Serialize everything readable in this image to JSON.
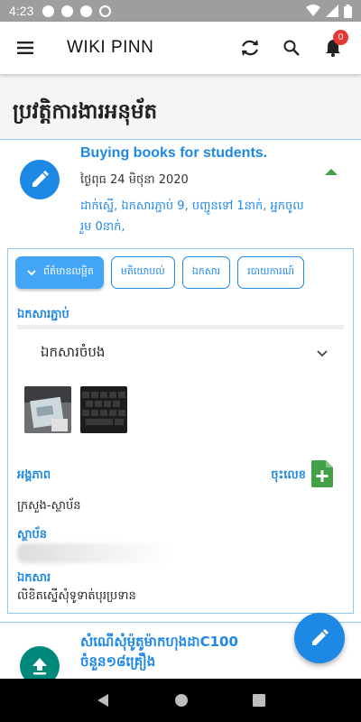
{
  "status_bar": {
    "time": "4:23"
  },
  "app_bar": {
    "title": "WIKI PINN",
    "notification_count": "0"
  },
  "page": {
    "title": "ប្រវត្តិការងារអនុម័ត"
  },
  "item": {
    "title": "Buying books for students.",
    "date": "ថ្ងៃពុធ 24 មិថុនា 2020",
    "meta": "ដាក់ស្នើ, ឯកសារភ្ជាប់ 9, បញ្ជូនទៅ 1នាក់, អ្នកចូលរួម 0នាក់,"
  },
  "tabs": [
    {
      "label": "ព័ត៌មានលម្អិត",
      "active": true
    },
    {
      "label": "មតិយោបល់",
      "active": false
    },
    {
      "label": "ឯកសារ",
      "active": false
    },
    {
      "label": "របាយការណ៍",
      "active": false
    }
  ],
  "details": {
    "attachments_label": "ឯកសារភ្ជាប់",
    "doc_select_value": "ឯកសារចំបង",
    "entity_label": "អង្គភាព",
    "sign_label": "ចុះលេខ",
    "entity_value": "ក្រសួង-ស្ថាប័ន",
    "institution_label": "ស្ថាប័ន",
    "document_label": "ឯកសារ",
    "document_value": "លិខិតស្នើសុំទូទាត់បុរប្រទាន"
  },
  "item2": {
    "title": "សំណើសុំម៉ូតូម៉ាកហុងដាC100 ចំនួន១៨គ្រឿង"
  },
  "colors": {
    "accent": "#1e88e5",
    "green": "#43a047",
    "teal": "#00897b",
    "badge": "#e53935"
  }
}
